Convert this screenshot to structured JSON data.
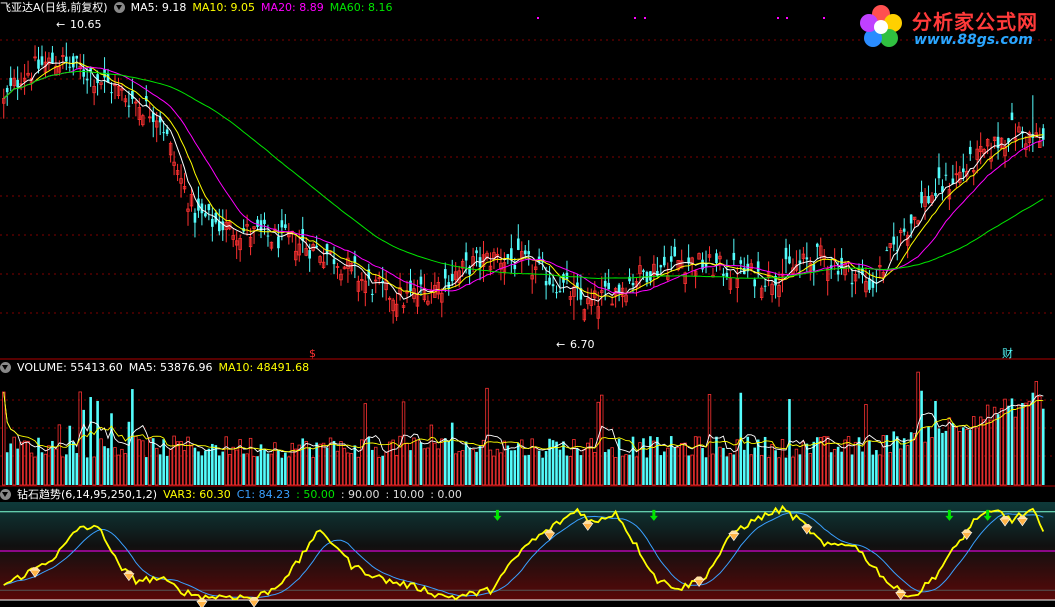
{
  "logo": {
    "title": "分析家公式网",
    "url": "www.88gs.com"
  },
  "price_panel": {
    "title": "飞亚达A(日线,前复权)",
    "ma5": "MA5: 9.18",
    "ma10": "MA10: 9.05",
    "ma20": "MA20: 8.89",
    "ma60": "MA60: 8.16",
    "high_label": "10.65",
    "low_label": "6.70",
    "marker_s": "$",
    "marker_cai": "财"
  },
  "volume_panel": {
    "title": "VOLUME: 55413.60",
    "ma5": "MA5: 53876.96",
    "ma10": "MA10: 48491.68"
  },
  "indicator_panel": {
    "title": "钻石趋势(6,14,95,250,1,2)",
    "var3": "VAR3: 60.30",
    "c1": "C1: 84.23",
    "l50": ": 50.00",
    "l90": ": 90.00",
    "l10": ": 10.00",
    "l0": ": 0.00"
  },
  "colors": {
    "up": "#ff3232",
    "down": "#54fcfc",
    "ma5": "#ffffff",
    "ma10": "#ffff00",
    "ma20": "#ff00ff",
    "ma60": "#00e600",
    "var3": "#ffff00",
    "c1": "#3aa0ff",
    "line90": "#7fffd4",
    "line50": "#ff00ff",
    "grid": "#800000",
    "panel_sep": "#b00000"
  },
  "chart_data": [
    {
      "type": "candlestick",
      "title": "飞亚达A(日线,前复权)",
      "series_names": [
        "MA5",
        "MA10",
        "MA20",
        "MA60"
      ],
      "ylim": [
        6.2,
        11.0
      ],
      "marked_values": {
        "high": 10.65,
        "low": 6.7
      },
      "close_keypoints": [
        [
          0,
          9.8
        ],
        [
          5,
          10.2
        ],
        [
          15,
          10.4
        ],
        [
          25,
          10.2
        ],
        [
          35,
          9.9
        ],
        [
          45,
          9.6
        ],
        [
          50,
          8.8
        ],
        [
          55,
          8.2
        ],
        [
          65,
          8.0
        ],
        [
          75,
          7.9
        ],
        [
          85,
          7.8
        ],
        [
          95,
          7.6
        ],
        [
          105,
          7.2
        ],
        [
          115,
          7.0
        ],
        [
          125,
          7.2
        ],
        [
          135,
          7.5
        ],
        [
          142,
          7.6
        ],
        [
          150,
          7.5
        ],
        [
          160,
          7.2
        ],
        [
          168,
          6.9
        ],
        [
          175,
          7.1
        ],
        [
          185,
          7.4
        ],
        [
          195,
          7.55
        ],
        [
          210,
          7.4
        ],
        [
          220,
          7.3
        ],
        [
          235,
          7.6
        ],
        [
          240,
          7.5
        ],
        [
          250,
          7.2
        ],
        [
          258,
          7.9
        ],
        [
          265,
          8.4
        ],
        [
          278,
          8.9
        ],
        [
          290,
          9.4
        ],
        [
          300,
          9.2
        ]
      ],
      "ma_end_values": {
        "MA5": 9.18,
        "MA10": 9.05,
        "MA20": 8.89,
        "MA60": 8.16
      }
    },
    {
      "type": "bar",
      "title": "VOLUME",
      "last_values": {
        "VOLUME": 55413.6,
        "MA5": 53876.96,
        "MA10": 48491.68
      }
    },
    {
      "type": "line",
      "title": "钻石趋势(6,14,95,250,1,2)",
      "ylim": [
        0,
        100
      ],
      "reference_lines": [
        0,
        10,
        50,
        90
      ],
      "last_values": {
        "VAR3": 60.3,
        "C1": 84.23
      },
      "var3_keypoints": [
        [
          0,
          15
        ],
        [
          8,
          30
        ],
        [
          15,
          45
        ],
        [
          22,
          75
        ],
        [
          28,
          72
        ],
        [
          33,
          35
        ],
        [
          38,
          20
        ],
        [
          45,
          22
        ],
        [
          52,
          8
        ],
        [
          58,
          3
        ],
        [
          65,
          4
        ],
        [
          72,
          2
        ],
        [
          78,
          12
        ],
        [
          85,
          40
        ],
        [
          90,
          70
        ],
        [
          96,
          55
        ],
        [
          100,
          35
        ],
        [
          110,
          20
        ],
        [
          120,
          12
        ],
        [
          125,
          5
        ],
        [
          130,
          3
        ],
        [
          140,
          10
        ],
        [
          150,
          55
        ],
        [
          158,
          75
        ],
        [
          165,
          92
        ],
        [
          170,
          78
        ],
        [
          176,
          90
        ],
        [
          182,
          55
        ],
        [
          188,
          20
        ],
        [
          195,
          12
        ],
        [
          202,
          25
        ],
        [
          210,
          70
        ],
        [
          218,
          85
        ],
        [
          224,
          93
        ],
        [
          230,
          78
        ],
        [
          236,
          55
        ],
        [
          244,
          58
        ],
        [
          250,
          35
        ],
        [
          256,
          12
        ],
        [
          262,
          4
        ],
        [
          268,
          25
        ],
        [
          274,
          55
        ],
        [
          280,
          85
        ],
        [
          286,
          90
        ],
        [
          290,
          82
        ],
        [
          296,
          92
        ],
        [
          300,
          60
        ]
      ]
    }
  ]
}
